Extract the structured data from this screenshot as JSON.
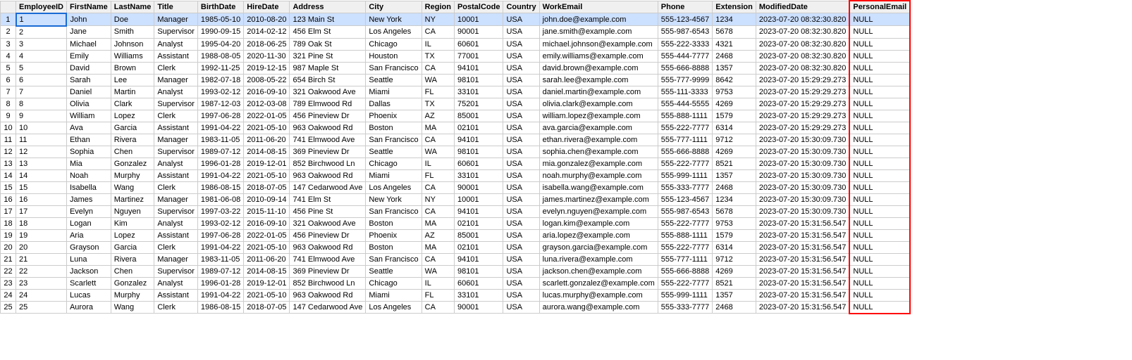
{
  "columns": [
    "",
    "EmployeeID",
    "FirstName",
    "LastName",
    "Title",
    "BirthDate",
    "HireDate",
    "Address",
    "City",
    "Region",
    "PostalCode",
    "Country",
    "WorkEmail",
    "Phone",
    "Extension",
    "ModifiedDate",
    "PersonalEmail"
  ],
  "rows": [
    [
      1,
      1,
      "John",
      "Doe",
      "Manager",
      "1985-05-10",
      "2010-08-20",
      "123 Main St",
      "New York",
      "NY",
      "10001",
      "USA",
      "john.doe@example.com",
      "555-123-4567",
      "1234",
      "2023-07-20 08:32:30.820",
      "NULL"
    ],
    [
      2,
      2,
      "Jane",
      "Smith",
      "Supervisor",
      "1990-09-15",
      "2014-02-12",
      "456 Elm St",
      "Los Angeles",
      "CA",
      "90001",
      "USA",
      "jane.smith@example.com",
      "555-987-6543",
      "5678",
      "2023-07-20 08:32:30.820",
      "NULL"
    ],
    [
      3,
      3,
      "Michael",
      "Johnson",
      "Analyst",
      "1995-04-20",
      "2018-06-25",
      "789 Oak St",
      "Chicago",
      "IL",
      "60601",
      "USA",
      "michael.johnson@example.com",
      "555-222-3333",
      "4321",
      "2023-07-20 08:32:30.820",
      "NULL"
    ],
    [
      4,
      4,
      "Emily",
      "Williams",
      "Assistant",
      "1988-08-05",
      "2020-11-30",
      "321 Pine St",
      "Houston",
      "TX",
      "77001",
      "USA",
      "emily.williams@example.com",
      "555-444-7777",
      "2468",
      "2023-07-20 08:32:30.820",
      "NULL"
    ],
    [
      5,
      5,
      "David",
      "Brown",
      "Clerk",
      "1992-11-25",
      "2019-12-15",
      "987 Maple St",
      "San Francisco",
      "CA",
      "94101",
      "USA",
      "david.brown@example.com",
      "555-666-8888",
      "1357",
      "2023-07-20 08:32:30.820",
      "NULL"
    ],
    [
      6,
      6,
      "Sarah",
      "Lee",
      "Manager",
      "1982-07-18",
      "2008-05-22",
      "654 Birch St",
      "Seattle",
      "WA",
      "98101",
      "USA",
      "sarah.lee@example.com",
      "555-777-9999",
      "8642",
      "2023-07-20 15:29:29.273",
      "NULL"
    ],
    [
      7,
      7,
      "Daniel",
      "Martin",
      "Analyst",
      "1993-02-12",
      "2016-09-10",
      "321 Oakwood Ave",
      "Miami",
      "FL",
      "33101",
      "USA",
      "daniel.martin@example.com",
      "555-111-3333",
      "9753",
      "2023-07-20 15:29:29.273",
      "NULL"
    ],
    [
      8,
      8,
      "Olivia",
      "Clark",
      "Supervisor",
      "1987-12-03",
      "2012-03-08",
      "789 Elmwood Rd",
      "Dallas",
      "TX",
      "75201",
      "USA",
      "olivia.clark@example.com",
      "555-444-5555",
      "4269",
      "2023-07-20 15:29:29.273",
      "NULL"
    ],
    [
      9,
      9,
      "William",
      "Lopez",
      "Clerk",
      "1997-06-28",
      "2022-01-05",
      "456 Pineview Dr",
      "Phoenix",
      "AZ",
      "85001",
      "USA",
      "william.lopez@example.com",
      "555-888-1111",
      "1579",
      "2023-07-20 15:29:29.273",
      "NULL"
    ],
    [
      10,
      10,
      "Ava",
      "Garcia",
      "Assistant",
      "1991-04-22",
      "2021-05-10",
      "963 Oakwood Rd",
      "Boston",
      "MA",
      "02101",
      "USA",
      "ava.garcia@example.com",
      "555-222-7777",
      "6314",
      "2023-07-20 15:29:29.273",
      "NULL"
    ],
    [
      11,
      11,
      "Ethan",
      "Rivera",
      "Manager",
      "1983-11-05",
      "2011-06-20",
      "741 Elmwood Ave",
      "San Francisco",
      "CA",
      "94101",
      "USA",
      "ethan.rivera@example.com",
      "555-777-1111",
      "9712",
      "2023-07-20 15:30:09.730",
      "NULL"
    ],
    [
      12,
      12,
      "Sophia",
      "Chen",
      "Supervisor",
      "1989-07-12",
      "2014-08-15",
      "369 Pineview Dr",
      "Seattle",
      "WA",
      "98101",
      "USA",
      "sophia.chen@example.com",
      "555-666-8888",
      "4269",
      "2023-07-20 15:30:09.730",
      "NULL"
    ],
    [
      13,
      13,
      "Mia",
      "Gonzalez",
      "Analyst",
      "1996-01-28",
      "2019-12-01",
      "852 Birchwood Ln",
      "Chicago",
      "IL",
      "60601",
      "USA",
      "mia.gonzalez@example.com",
      "555-222-7777",
      "8521",
      "2023-07-20 15:30:09.730",
      "NULL"
    ],
    [
      14,
      14,
      "Noah",
      "Murphy",
      "Assistant",
      "1991-04-22",
      "2021-05-10",
      "963 Oakwood Rd",
      "Miami",
      "FL",
      "33101",
      "USA",
      "noah.murphy@example.com",
      "555-999-1111",
      "1357",
      "2023-07-20 15:30:09.730",
      "NULL"
    ],
    [
      15,
      15,
      "Isabella",
      "Wang",
      "Clerk",
      "1986-08-15",
      "2018-07-05",
      "147 Cedarwood Ave",
      "Los Angeles",
      "CA",
      "90001",
      "USA",
      "isabella.wang@example.com",
      "555-333-7777",
      "2468",
      "2023-07-20 15:30:09.730",
      "NULL"
    ],
    [
      16,
      16,
      "James",
      "Martinez",
      "Manager",
      "1981-06-08",
      "2010-09-14",
      "741 Elm St",
      "New York",
      "NY",
      "10001",
      "USA",
      "james.martinez@example.com",
      "555-123-4567",
      "1234",
      "2023-07-20 15:30:09.730",
      "NULL"
    ],
    [
      17,
      17,
      "Evelyn",
      "Nguyen",
      "Supervisor",
      "1997-03-22",
      "2015-11-10",
      "456 Pine St",
      "San Francisco",
      "CA",
      "94101",
      "USA",
      "evelyn.nguyen@example.com",
      "555-987-6543",
      "5678",
      "2023-07-20 15:30:09.730",
      "NULL"
    ],
    [
      18,
      18,
      "Logan",
      "Kim",
      "Analyst",
      "1993-02-12",
      "2016-09-10",
      "321 Oakwood Ave",
      "Boston",
      "MA",
      "02101",
      "USA",
      "logan.kim@example.com",
      "555-222-7777",
      "9753",
      "2023-07-20 15:31:56.547",
      "NULL"
    ],
    [
      19,
      19,
      "Aria",
      "Lopez",
      "Assistant",
      "1997-06-28",
      "2022-01-05",
      "456 Pineview Dr",
      "Phoenix",
      "AZ",
      "85001",
      "USA",
      "aria.lopez@example.com",
      "555-888-1111",
      "1579",
      "2023-07-20 15:31:56.547",
      "NULL"
    ],
    [
      20,
      20,
      "Grayson",
      "Garcia",
      "Clerk",
      "1991-04-22",
      "2021-05-10",
      "963 Oakwood Rd",
      "Boston",
      "MA",
      "02101",
      "USA",
      "grayson.garcia@example.com",
      "555-222-7777",
      "6314",
      "2023-07-20 15:31:56.547",
      "NULL"
    ],
    [
      21,
      21,
      "Luna",
      "Rivera",
      "Manager",
      "1983-11-05",
      "2011-06-20",
      "741 Elmwood Ave",
      "San Francisco",
      "CA",
      "94101",
      "USA",
      "luna.rivera@example.com",
      "555-777-1111",
      "9712",
      "2023-07-20 15:31:56.547",
      "NULL"
    ],
    [
      22,
      22,
      "Jackson",
      "Chen",
      "Supervisor",
      "1989-07-12",
      "2014-08-15",
      "369 Pineview Dr",
      "Seattle",
      "WA",
      "98101",
      "USA",
      "jackson.chen@example.com",
      "555-666-8888",
      "4269",
      "2023-07-20 15:31:56.547",
      "NULL"
    ],
    [
      23,
      23,
      "Scarlett",
      "Gonzalez",
      "Analyst",
      "1996-01-28",
      "2019-12-01",
      "852 Birchwood Ln",
      "Chicago",
      "IL",
      "60601",
      "USA",
      "scarlett.gonzalez@example.com",
      "555-222-7777",
      "8521",
      "2023-07-20 15:31:56.547",
      "NULL"
    ],
    [
      24,
      24,
      "Lucas",
      "Murphy",
      "Assistant",
      "1991-04-22",
      "2021-05-10",
      "963 Oakwood Rd",
      "Miami",
      "FL",
      "33101",
      "USA",
      "lucas.murphy@example.com",
      "555-999-1111",
      "1357",
      "2023-07-20 15:31:56.547",
      "NULL"
    ],
    [
      25,
      25,
      "Aurora",
      "Wang",
      "Clerk",
      "1986-08-15",
      "2018-07-05",
      "147 Cedarwood Ave",
      "Los Angeles",
      "CA",
      "90001",
      "USA",
      "aurora.wang@example.com",
      "555-333-7777",
      "2468",
      "2023-07-20 15:31:56.547",
      "NULL"
    ]
  ]
}
